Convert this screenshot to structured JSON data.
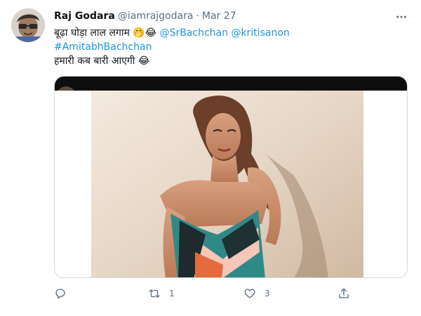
{
  "tweet": {
    "author_name": "Raj Godara",
    "handle": "@iamrajgodara",
    "separator": "·",
    "date": "Mar 27",
    "text_line1_prefix": "बूढ़ा घोड़ा लाल लगाम",
    "emoji_1": "🤭",
    "emoji_2": "😂",
    "mention_1": "@SrBachchan",
    "mention_2": "@kritisanon",
    "hashtag": "#AmitabhBachchan",
    "text_line3": "हमारी कब बारी आएगी",
    "emoji_3": "😂"
  },
  "actions": {
    "reply_icon": "reply-icon",
    "retweet_icon": "retweet-icon",
    "retweet_count": "1",
    "like_icon": "heart-icon",
    "like_count": "3",
    "share_icon": "share-icon"
  },
  "colors": {
    "link": "#1b95e0",
    "secondary_text": "#5b7083",
    "border": "#cfd9de"
  }
}
